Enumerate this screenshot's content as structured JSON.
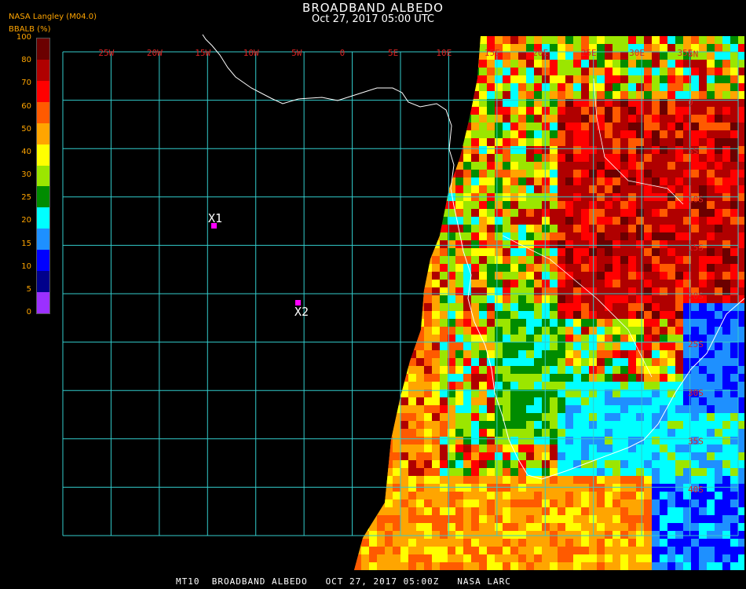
{
  "header": {
    "title": "BROADBAND ALBEDO",
    "subtitle": "Oct 27, 2017 05:00 UTC",
    "credit": "NASA Langley (M04.0)",
    "units": "BBALB (%)"
  },
  "colorbar": {
    "ticks": [
      "100",
      "90",
      "80",
      "70",
      "60",
      "50",
      "40",
      "30",
      "25",
      "20",
      "15",
      "10",
      "5",
      "0"
    ],
    "labels_shown": [
      "100",
      "80",
      "70",
      "60",
      "50",
      "40",
      "30",
      "25",
      "20",
      "15",
      "10",
      "5",
      "0"
    ],
    "colors": [
      "#6b0000",
      "#b00000",
      "#ff0000",
      "#ff5a00",
      "#ffa500",
      "#ffff00",
      "#9be600",
      "#008c00",
      "#00ffff",
      "#1e90ff",
      "#0000ff",
      "#00008b",
      "#9b30ff"
    ]
  },
  "map": {
    "lon_labels": [
      "25W",
      "20W",
      "15W",
      "10W",
      "5W",
      "0",
      "5E",
      "10E",
      "15E",
      "20E",
      "25E",
      "30E",
      "35E"
    ],
    "lat_labels": [
      "5N",
      "0",
      "5S",
      "10S",
      "15S",
      "20S",
      "25S",
      "30S",
      "35S",
      "40S"
    ],
    "markers": [
      {
        "label": "X1",
        "color": "#ff00ff"
      },
      {
        "label": "X2",
        "color": "#ff00ff"
      }
    ]
  },
  "footer": "MT10  BROADBAND ALBEDO   OCT 27, 2017 05:00Z   NASA LARC"
}
